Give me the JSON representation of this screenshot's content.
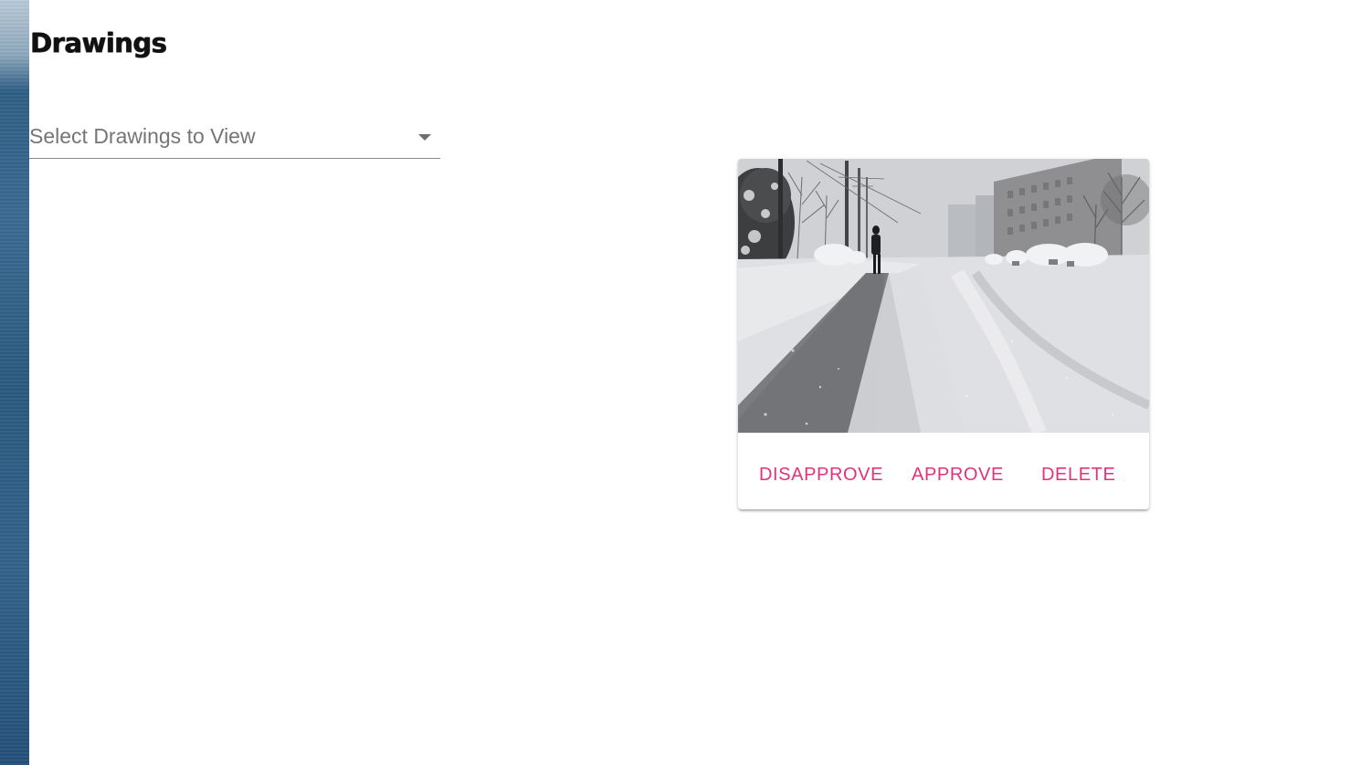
{
  "page": {
    "title": "Drawings"
  },
  "select": {
    "placeholder": "Select Drawings to View"
  },
  "card": {
    "image_alt": "Snowy street with a person walking on a sidewalk",
    "actions": {
      "disapprove_label": "DISAPPROVE",
      "approve_label": "APPROVE",
      "delete_label": "DELETE"
    }
  },
  "colors": {
    "accent": "#e0337a",
    "select_underline": "#8a8a8a",
    "placeholder_text": "#757575"
  },
  "icons": {
    "select_caret": "chevron-down-icon"
  }
}
